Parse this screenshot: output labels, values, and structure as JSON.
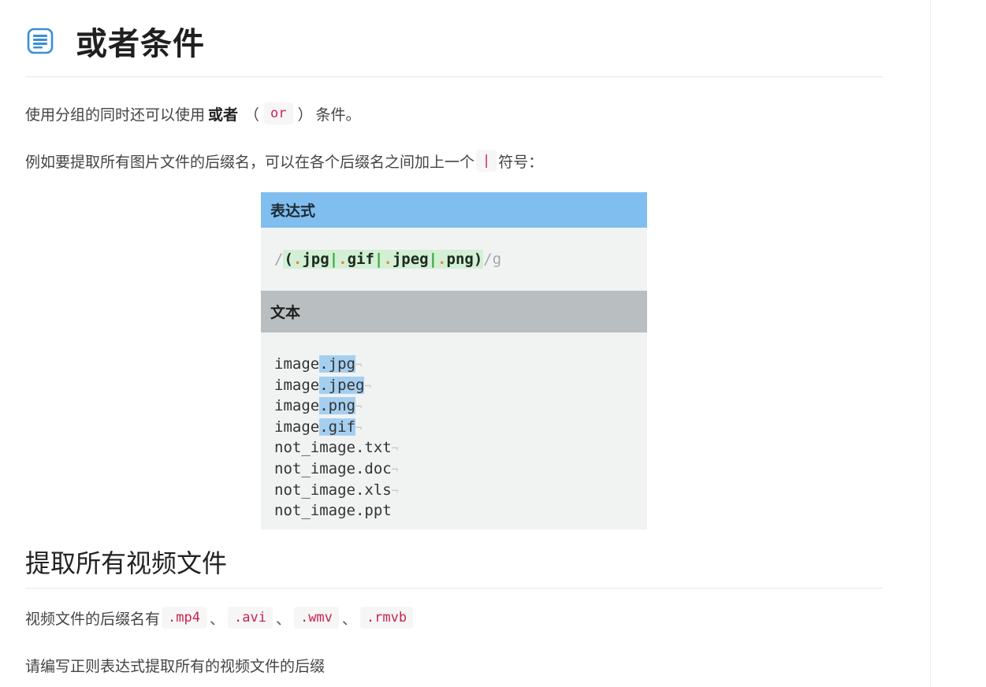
{
  "heading": "或者条件",
  "intro": {
    "before": "使用分组的同时还可以使用",
    "bold": "或者",
    "open_paren": "（",
    "code": "or",
    "close_paren": "）",
    "after": "条件。"
  },
  "example": {
    "before": "例如要提取所有图片文件的后缀名，可以在各个后缀名之间加上一个",
    "code": "|",
    "after": "符号："
  },
  "figure": {
    "expr_header": "表达式",
    "regex": {
      "open": "/",
      "lparen": "(",
      "alts": [
        ".jpg",
        ".gif",
        ".jpeg",
        ".png"
      ],
      "rparen": ")",
      "close": "/",
      "flag": "g"
    },
    "text_header": "文本",
    "lines": [
      {
        "base": "image",
        "match": ".jpg",
        "newline": "¬"
      },
      {
        "base": "image",
        "match": ".jpeg",
        "newline": "¬"
      },
      {
        "base": "image",
        "match": ".png",
        "newline": "¬"
      },
      {
        "base": "image",
        "match": ".gif",
        "newline": "¬"
      },
      {
        "base": "not_image.txt",
        "match": "",
        "newline": "¬"
      },
      {
        "base": "not_image.doc",
        "match": "",
        "newline": "¬"
      },
      {
        "base": "not_image.xls",
        "match": "",
        "newline": "¬"
      },
      {
        "base": "not_image.ppt",
        "match": "",
        "newline": ""
      }
    ]
  },
  "section2": {
    "heading": "提取所有视频文件",
    "formats_label": "视频文件的后缀名有",
    "formats": [
      ".mp4",
      ".avi",
      ".wmv",
      ".rmvb"
    ],
    "separator": "、",
    "task": "请编写正则表达式提取所有的视频文件的后缀"
  },
  "colors": {
    "expr_header_bg": "#80bef0",
    "text_header_bg": "#b9bec1",
    "match_highlight": "#a5cff0",
    "group_highlight": "#d3efd6",
    "code_text": "#c7254e",
    "icon_accent": "#3a8fd6"
  },
  "icons": {
    "heading": "document-list-icon"
  }
}
